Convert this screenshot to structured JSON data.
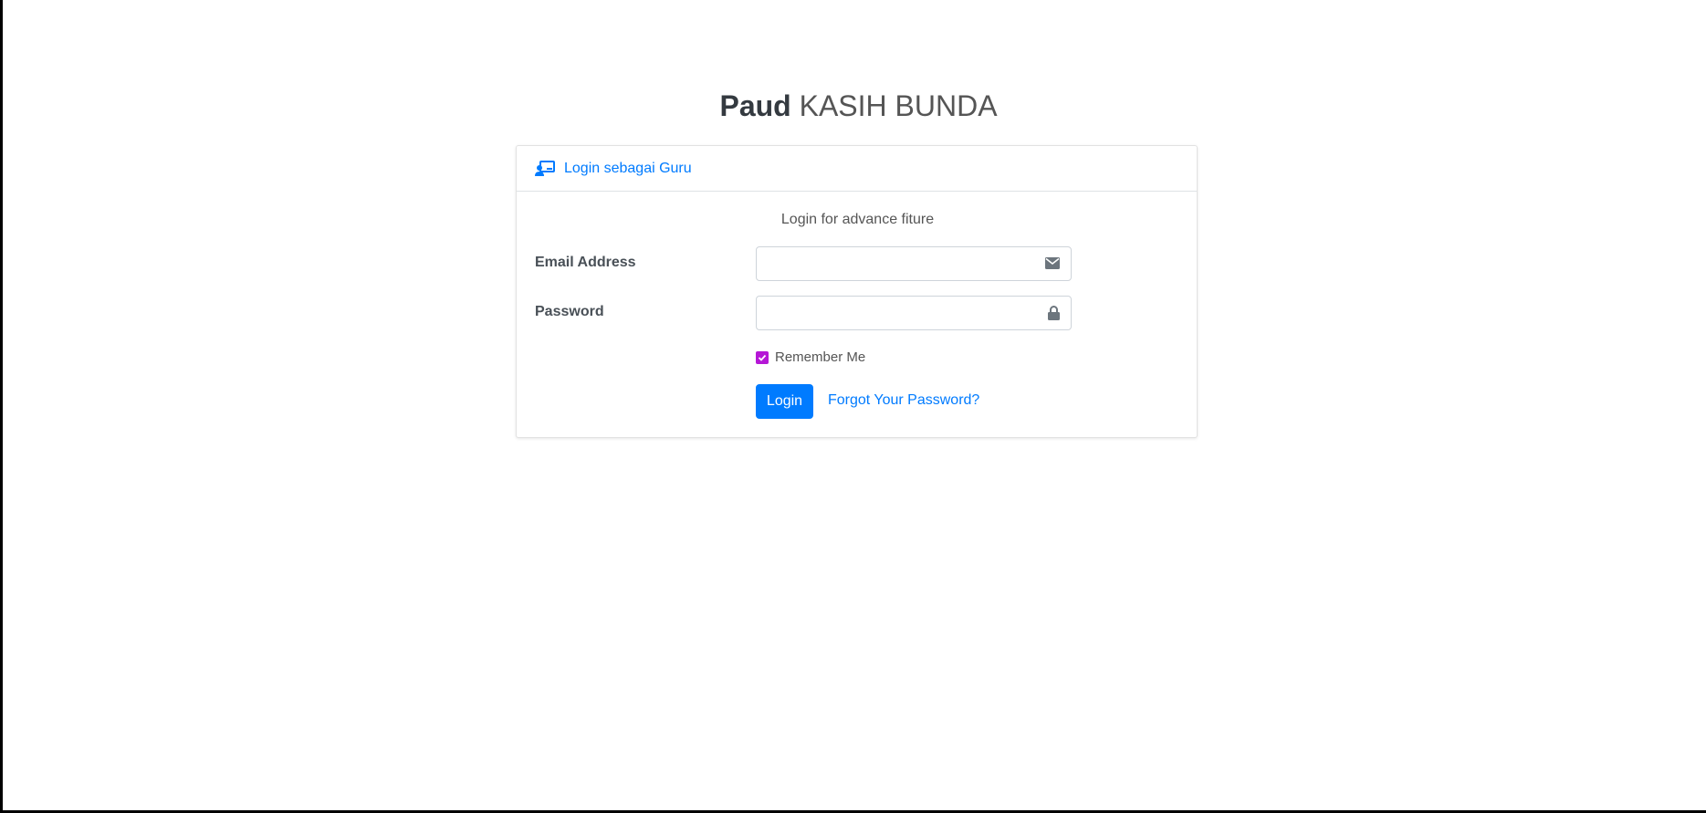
{
  "brand": {
    "bold": "Paud",
    "light": "KASIH BUNDA"
  },
  "card": {
    "header_link": "Login sebagai Guru",
    "header_icon": "chalkboard-teacher-icon",
    "subtitle": "Login for advance fiture"
  },
  "form": {
    "email_label": "Email Address",
    "email_value": "",
    "email_icon": "envelope-icon",
    "password_label": "Password",
    "password_value": "",
    "password_icon": "lock-icon",
    "remember_label": "Remember Me",
    "remember_checked": true,
    "login_button": "Login",
    "forgot_link": "Forgot Your Password?"
  },
  "colors": {
    "accent": "#007bff",
    "checkbox": "#b517d6",
    "text": "#495057"
  }
}
